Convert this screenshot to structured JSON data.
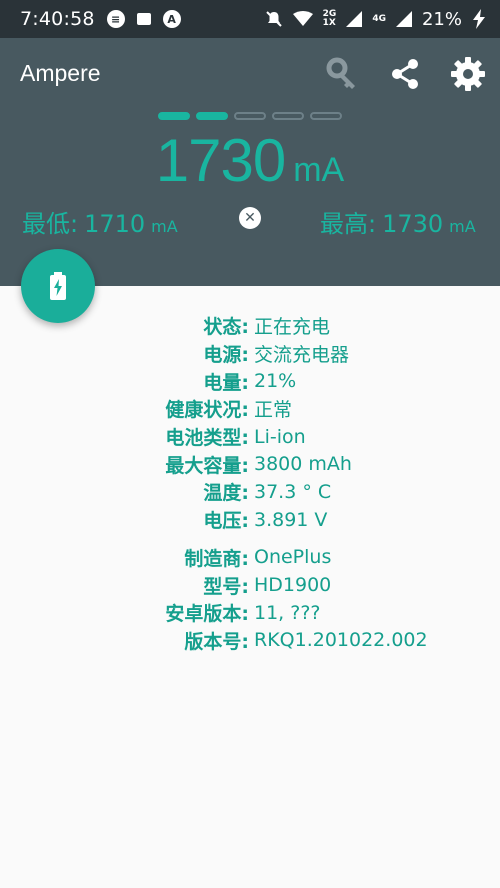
{
  "status_bar": {
    "time": "7:40:58",
    "net_top": "2G",
    "net_bottom": "1X",
    "net2": "4G",
    "battery_pct": "21%"
  },
  "app": {
    "title": "Ampere",
    "icons": [
      "key-icon",
      "share-icon",
      "gear-icon"
    ]
  },
  "meter": {
    "dashes": [
      true,
      true,
      false,
      false,
      false
    ],
    "current": "1730",
    "unit": "mA",
    "min_label": "最低:",
    "min_value": "1710",
    "max_label": "最高:",
    "max_value": "1730",
    "mm_unit": "mA"
  },
  "info": {
    "status": {
      "key": "状态:",
      "value": "正在充电"
    },
    "source": {
      "key": "电源:",
      "value": "交流充电器"
    },
    "level": {
      "key": "电量:",
      "value": "21%"
    },
    "health": {
      "key": "健康状况:",
      "value": "正常"
    },
    "type": {
      "key": "电池类型:",
      "value": "Li-ion"
    },
    "capacity": {
      "key": "最大容量:",
      "value": "3800 mAh"
    },
    "temp": {
      "key": "温度:",
      "value": "37.3 ° C"
    },
    "voltage": {
      "key": "电压:",
      "value": "3.891 V"
    },
    "maker": {
      "key": "制造商:",
      "value": "OnePlus"
    },
    "model": {
      "key": "型号:",
      "value": "HD1900"
    },
    "android": {
      "key": "安卓版本:",
      "value": "11, ???"
    },
    "build": {
      "key": "版本号:",
      "value": "RKQ1.201022.002"
    }
  },
  "colors": {
    "accent": "#19b5a0",
    "header": "#485960",
    "status_bar": "#2a3338"
  }
}
